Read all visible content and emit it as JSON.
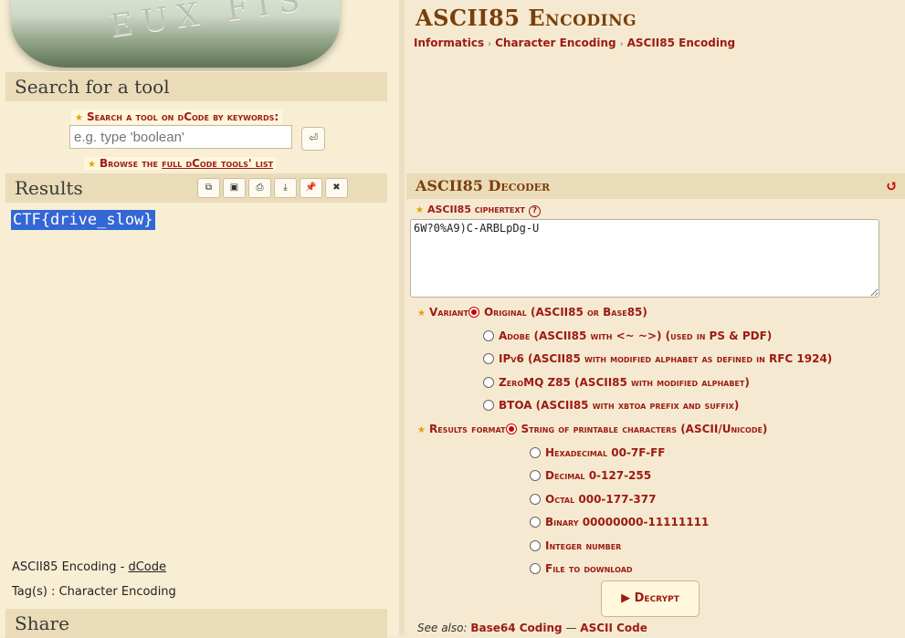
{
  "search": {
    "heading": "Search for a tool",
    "label": "Search a tool on dCode by keywords:",
    "placeholder": "e.g. type 'boolean'",
    "go_icon": "enter-icon",
    "browse_prefix": "Browse the ",
    "browse_link": "full dCode tools' list"
  },
  "results": {
    "heading": "Results",
    "toolbar": [
      {
        "name": "copy-icon",
        "glyph": "⧉"
      },
      {
        "name": "screenshot-icon",
        "glyph": "▣"
      },
      {
        "name": "print-icon",
        "glyph": "⎙"
      },
      {
        "name": "download-icon",
        "glyph": "⤓"
      },
      {
        "name": "pin-icon",
        "glyph": "📌"
      },
      {
        "name": "close-icon",
        "glyph": "✖"
      }
    ],
    "output": "CTF{drive_slow}",
    "footer_title": "ASCII85 Encoding - ",
    "footer_link": "dCode",
    "tags": "Tag(s) : Character Encoding"
  },
  "share": {
    "heading": "Share"
  },
  "page": {
    "title": "ASCII85 Encoding",
    "breadcrumb": [
      "Informatics",
      "Character Encoding",
      "ASCII85 Encoding"
    ]
  },
  "decoder": {
    "heading": "ASCII85 Decoder",
    "ciphertext_label": "ASCII85 ciphertext",
    "ciphertext_value": "6W?0%A9)C-ARBLpDg-U",
    "variant_label": "Variant",
    "variants": [
      "Original (ASCII85 or Base85)",
      "Adobe (ASCII85 with <~ ~>) (used in PS & PDF)",
      "IPv6 (ASCII85 with modified alphabet as defined in RFC 1924)",
      "ZeroMQ Z85 (ASCII85 with modified alphabet)",
      "BTOA (ASCII85 with xbtoa prefix and suffix)"
    ],
    "variant_selected": 0,
    "format_label": "Results format",
    "formats": [
      "String of printable characters (ASCII/Unicode)",
      "Hexadecimal 00-7F-FF",
      "Decimal 0-127-255",
      "Octal 000-177-377",
      "Binary 00000000-11111111",
      "Integer number",
      "File to download"
    ],
    "format_selected": 0,
    "button": "Decrypt"
  },
  "see_also": {
    "prefix": "See also: ",
    "links": [
      "Base64 Coding",
      "ASCII Code"
    ],
    "separator": " — "
  },
  "colors": {
    "accent": "#9d1a12",
    "title": "#7a3e0c",
    "highlight": "#3367d6"
  }
}
